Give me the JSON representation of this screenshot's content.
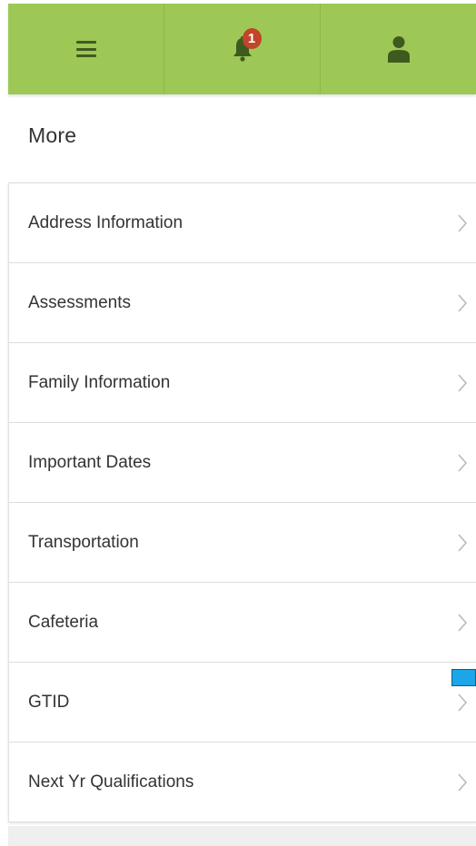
{
  "header": {
    "menu_icon": "hamburger-menu-icon",
    "notifications_icon": "bell-icon",
    "notifications_count": "1",
    "profile_icon": "person-icon"
  },
  "page": {
    "title": "More"
  },
  "menu": {
    "items": [
      {
        "label": "Address Information"
      },
      {
        "label": "Assessments"
      },
      {
        "label": "Family Information"
      },
      {
        "label": "Important Dates"
      },
      {
        "label": "Transportation"
      },
      {
        "label": "Cafeteria"
      },
      {
        "label": "GTID"
      },
      {
        "label": "Next Yr Qualifications"
      }
    ]
  },
  "colors": {
    "header_bg": "#9dc856",
    "icon": "#3f5a1f",
    "badge": "#c0452b",
    "text": "#333333",
    "chevron": "#bbbbbb",
    "marker": "#1aa6e8"
  }
}
